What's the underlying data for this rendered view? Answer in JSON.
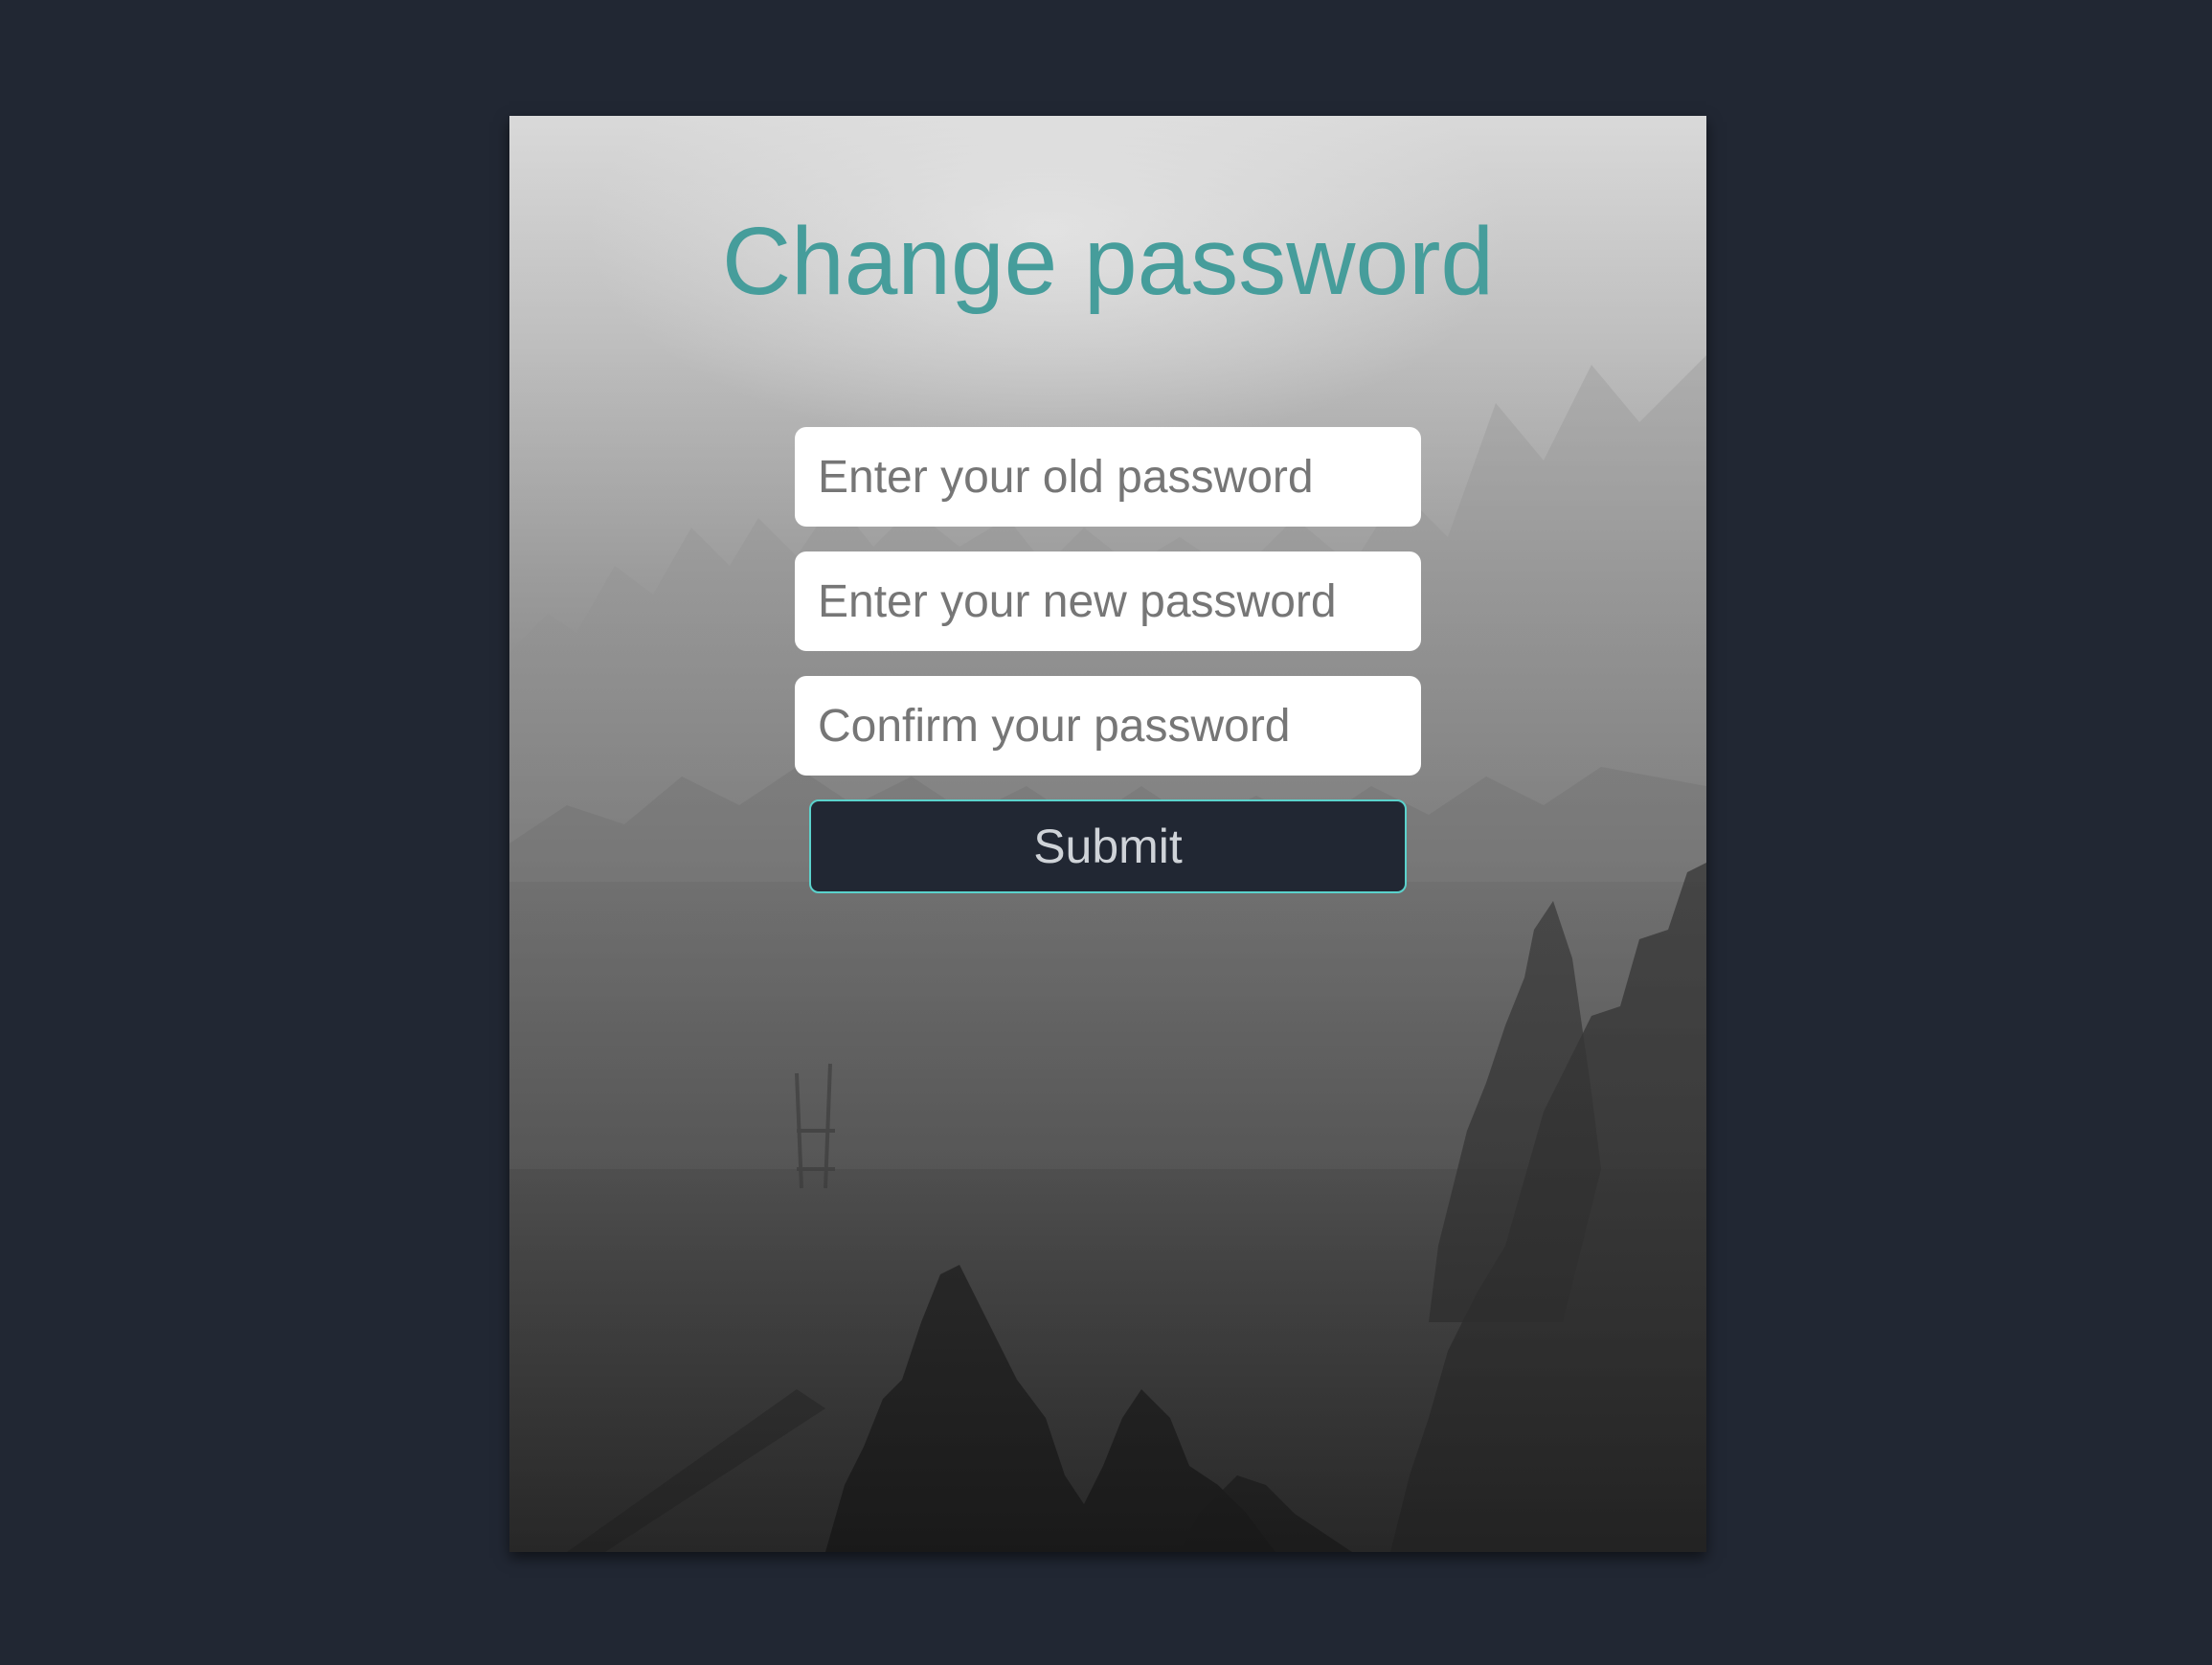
{
  "page": {
    "background_color": "#212733"
  },
  "form": {
    "title": "Change password",
    "title_color": "#469d9b",
    "old_password": {
      "placeholder": "Enter your old password",
      "value": ""
    },
    "new_password": {
      "placeholder": "Enter your new password",
      "value": ""
    },
    "confirm_password": {
      "placeholder": "Confirm your password",
      "value": ""
    },
    "submit_label": "Submit",
    "accent_color": "#5bd2cc"
  },
  "background_image": {
    "icon": "misty-forest-photo"
  }
}
